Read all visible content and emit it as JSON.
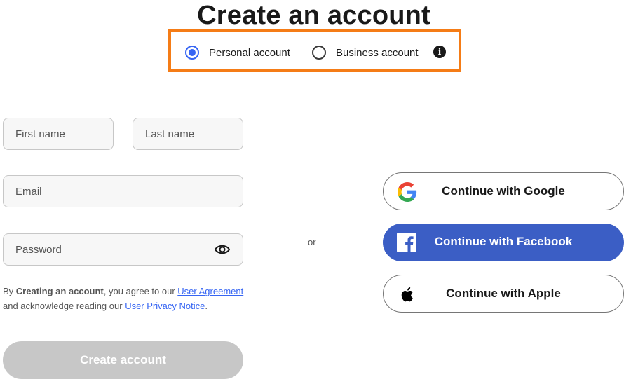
{
  "page": {
    "title": "Create an account"
  },
  "account_type": {
    "options": [
      {
        "label": "Personal account",
        "selected": true
      },
      {
        "label": "Business account",
        "selected": false
      }
    ],
    "info_icon": "info-icon",
    "highlight_color": "#f57c16",
    "radio_color": "#3665f3"
  },
  "form": {
    "first_name_placeholder": "First name",
    "last_name_placeholder": "Last name",
    "email_placeholder": "Email",
    "password_placeholder": "Password",
    "password_icon": "eye-icon"
  },
  "legal": {
    "prefix": "By ",
    "bold": "Creating an account",
    "mid1": ", you agree to our ",
    "link1": "User Agreement",
    "mid2": " and acknowledge reading our ",
    "link2": "User Privacy Notice",
    "suffix": "."
  },
  "create_button": {
    "label": "Create account",
    "color": "#c7c7c7"
  },
  "divider": {
    "label": "or"
  },
  "social": {
    "google": {
      "label": "Continue with Google",
      "icon": "google-icon"
    },
    "facebook": {
      "label": "Continue with Facebook",
      "icon": "facebook-icon",
      "color": "#3b5ec5"
    },
    "apple": {
      "label": "Continue with Apple",
      "icon": "apple-icon"
    }
  }
}
